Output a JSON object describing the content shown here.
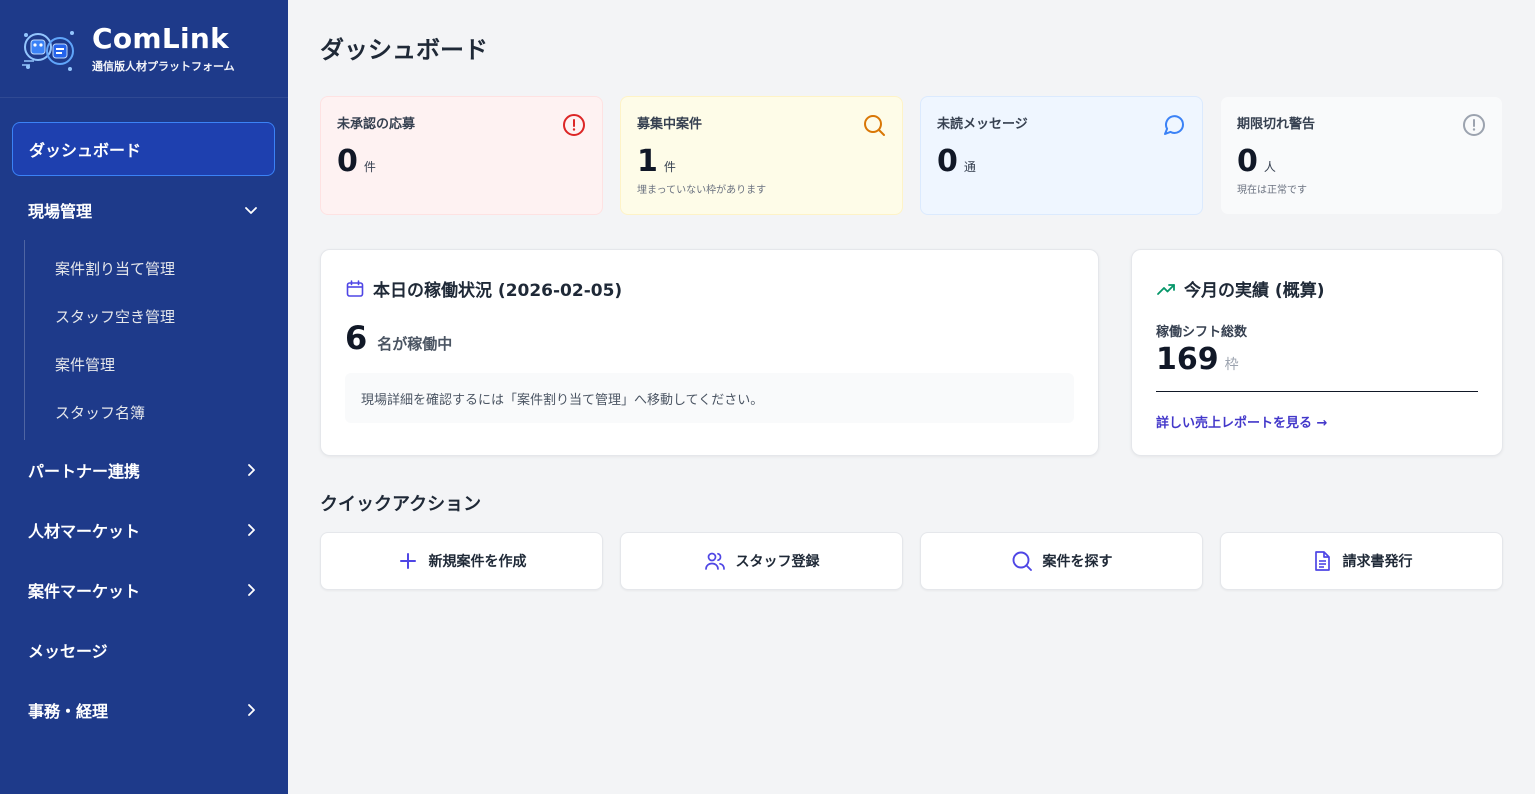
{
  "brand": {
    "name": "ComLink",
    "subtitle": "通信版人材プラットフォーム"
  },
  "sidebar": {
    "active": "ダッシュボード",
    "genba": {
      "label": "現場管理",
      "children": [
        "案件割り当て管理",
        "スタッフ空き管理",
        "案件管理",
        "スタッフ名簿"
      ]
    },
    "items": [
      "パートナー連携",
      "人材マーケット",
      "案件マーケット",
      "メッセージ",
      "事務・経理"
    ]
  },
  "page": {
    "title": "ダッシュボード"
  },
  "stats": [
    {
      "title": "未承認の応募",
      "value": "0",
      "unit": "件",
      "note": "",
      "icon": "alert-circle-icon",
      "bg": "#fef2f2",
      "border": "#fee2e2",
      "color": "#dc2626"
    },
    {
      "title": "募集中案件",
      "value": "1",
      "unit": "件",
      "note": "埋まっていない枠があります",
      "icon": "search-icon",
      "bg": "#fefce8",
      "border": "#fef3c7",
      "color": "#d97706"
    },
    {
      "title": "未読メッセージ",
      "value": "0",
      "unit": "通",
      "note": "",
      "icon": "message-circle-icon",
      "bg": "#eff6ff",
      "border": "#dbeafe",
      "color": "#3b82f6"
    },
    {
      "title": "期限切れ警告",
      "value": "0",
      "unit": "人",
      "note": "現在は正常です",
      "icon": "alert-circle-icon",
      "bg": "#f9fafb",
      "border": "#f3f4f6",
      "color": "#9ca3af"
    }
  ],
  "today": {
    "title": "本日の稼働状況 (2026-02-05)",
    "count": "6",
    "count_label": "名が稼働中",
    "info": "現場詳細を確認するには「案件割り当て管理」へ移動してください。"
  },
  "month": {
    "title": "今月の実績 (概算)",
    "label": "稼働シフト総数",
    "value": "169",
    "unit": "枠",
    "link": "詳しい売上レポートを見る →"
  },
  "quick": {
    "title": "クイックアクション",
    "actions": [
      "新規案件を作成",
      "スタッフ登録",
      "案件を探す",
      "請求書発行"
    ]
  },
  "colors": {
    "sidebar": "#1e3a8a",
    "accent": "#4f46e5",
    "link": "#4338ca"
  }
}
